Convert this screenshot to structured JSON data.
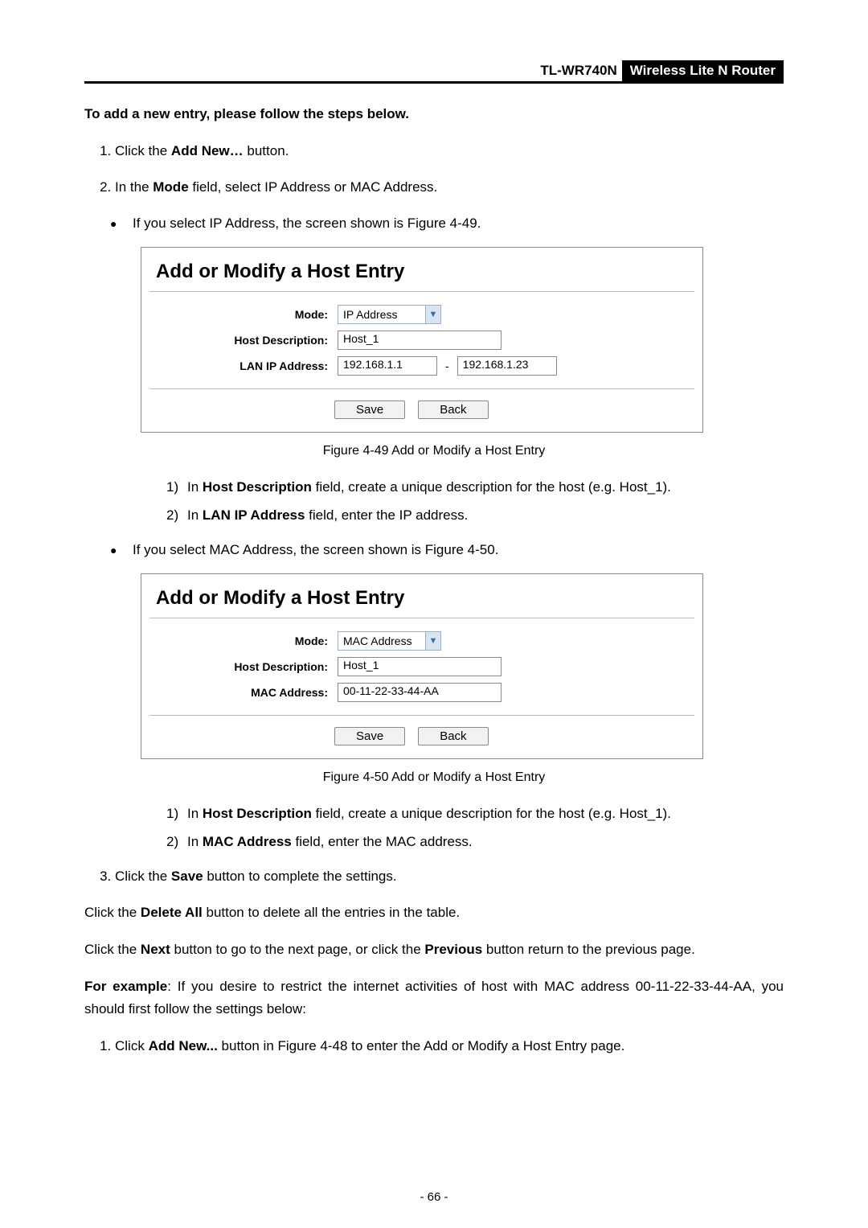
{
  "header": {
    "model": "TL-WR740N",
    "subtitle": "Wireless Lite N Router"
  },
  "intro": "To add a new entry, please follow the steps below.",
  "step1": {
    "prefix": "Click the ",
    "bold": "Add New…",
    "suffix": " button."
  },
  "step2": {
    "prefix": "In the ",
    "bold": "Mode",
    "suffix": " field, select IP Address or MAC Address."
  },
  "bullet_ip": "If you select IP Address, the screen shown is Figure 4-49.",
  "fig49": {
    "title": "Add or Modify a Host Entry",
    "mode_label": "Mode:",
    "mode_value": "IP Address",
    "host_desc_label": "Host Description:",
    "host_desc_value": "Host_1",
    "lan_ip_label": "LAN IP Address:",
    "ip_from": "192.168.1.1",
    "ip_dash": "-",
    "ip_to": "192.168.1.23",
    "save": "Save",
    "back": "Back",
    "caption": "Figure 4-49    Add or Modify a Host Entry"
  },
  "sub49_1": {
    "prefix": "In ",
    "bold": "Host Description",
    "suffix": " field, create a unique description for the host (e.g. Host_1)."
  },
  "sub49_2": {
    "prefix": "In ",
    "bold": "LAN IP Address",
    "suffix": " field, enter the IP address."
  },
  "bullet_mac": "If you select MAC Address, the screen shown is Figure 4-50.",
  "fig50": {
    "title": "Add or Modify a Host Entry",
    "mode_label": "Mode:",
    "mode_value": "MAC Address",
    "host_desc_label": "Host Description:",
    "host_desc_value": "Host_1",
    "mac_label": "MAC Address:",
    "mac_value": "00-11-22-33-44-AA",
    "save": "Save",
    "back": "Back",
    "caption": "Figure 4-50    Add or Modify a Host Entry"
  },
  "sub50_1": {
    "prefix": "In ",
    "bold": "Host Description",
    "suffix": " field, create a unique description for the host (e.g. Host_1)."
  },
  "sub50_2": {
    "prefix": "In ",
    "bold": "MAC Address",
    "suffix": " field, enter the MAC address."
  },
  "step3": {
    "prefix": "Click the ",
    "bold": "Save",
    "suffix": " button to complete the settings."
  },
  "para_delete": {
    "prefix": "Click the ",
    "bold": "Delete All",
    "suffix": " button to delete all the entries in the table."
  },
  "para_nav": {
    "p1": "Click the ",
    "b1": "Next",
    "p2": " button to go to the next page, or click the ",
    "b2": "Previous",
    "p3": " button return to the previous page."
  },
  "para_example": {
    "b1": "For example",
    "rest": ": If you desire to restrict the internet activities of host with MAC address 00-11-22-33-44-AA, you should first follow the settings below:"
  },
  "step_ex1": {
    "prefix": "Click ",
    "bold": "Add New...",
    "suffix": " button in Figure 4-48 to enter the Add or Modify a Host Entry page."
  },
  "page_number": "- 66 -"
}
